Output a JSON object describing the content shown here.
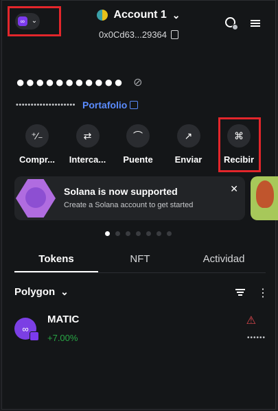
{
  "header": {
    "network_icon": "polygon-icon",
    "account_name": "Account 1",
    "account_address": "0x0Cd63...29364",
    "globe_icon": "globe-icon",
    "menu_icon": "hamburger-menu-icon"
  },
  "balance": {
    "masked": "●●●●●●●●●●●",
    "hide_icon": "eye-slash-icon",
    "portfolio_masked": "••••••••••••••••••••",
    "portfolio_label": "Portafolio"
  },
  "actions": [
    {
      "label": "Compr...",
      "icon": "buy-sell-icon"
    },
    {
      "label": "Interca...",
      "icon": "swap-icon"
    },
    {
      "label": "Puente",
      "icon": "bridge-icon"
    },
    {
      "label": "Enviar",
      "icon": "send-arrow-icon"
    },
    {
      "label": "Recibir",
      "icon": "qr-code-icon"
    }
  ],
  "banner": {
    "title": "Solana is now supported",
    "subtitle": "Create a Solana account to get started"
  },
  "tabs": [
    "Tokens",
    "NFT",
    "Actividad"
  ],
  "network_filter": "Polygon",
  "tokens": [
    {
      "symbol": "MATIC",
      "change": "+7.00%",
      "balance_masked": "••••••"
    }
  ],
  "colors": {
    "accent_link": "#5b8cff",
    "positive": "#28a745",
    "warning": "#e0484e",
    "highlight": "#e3262b"
  }
}
